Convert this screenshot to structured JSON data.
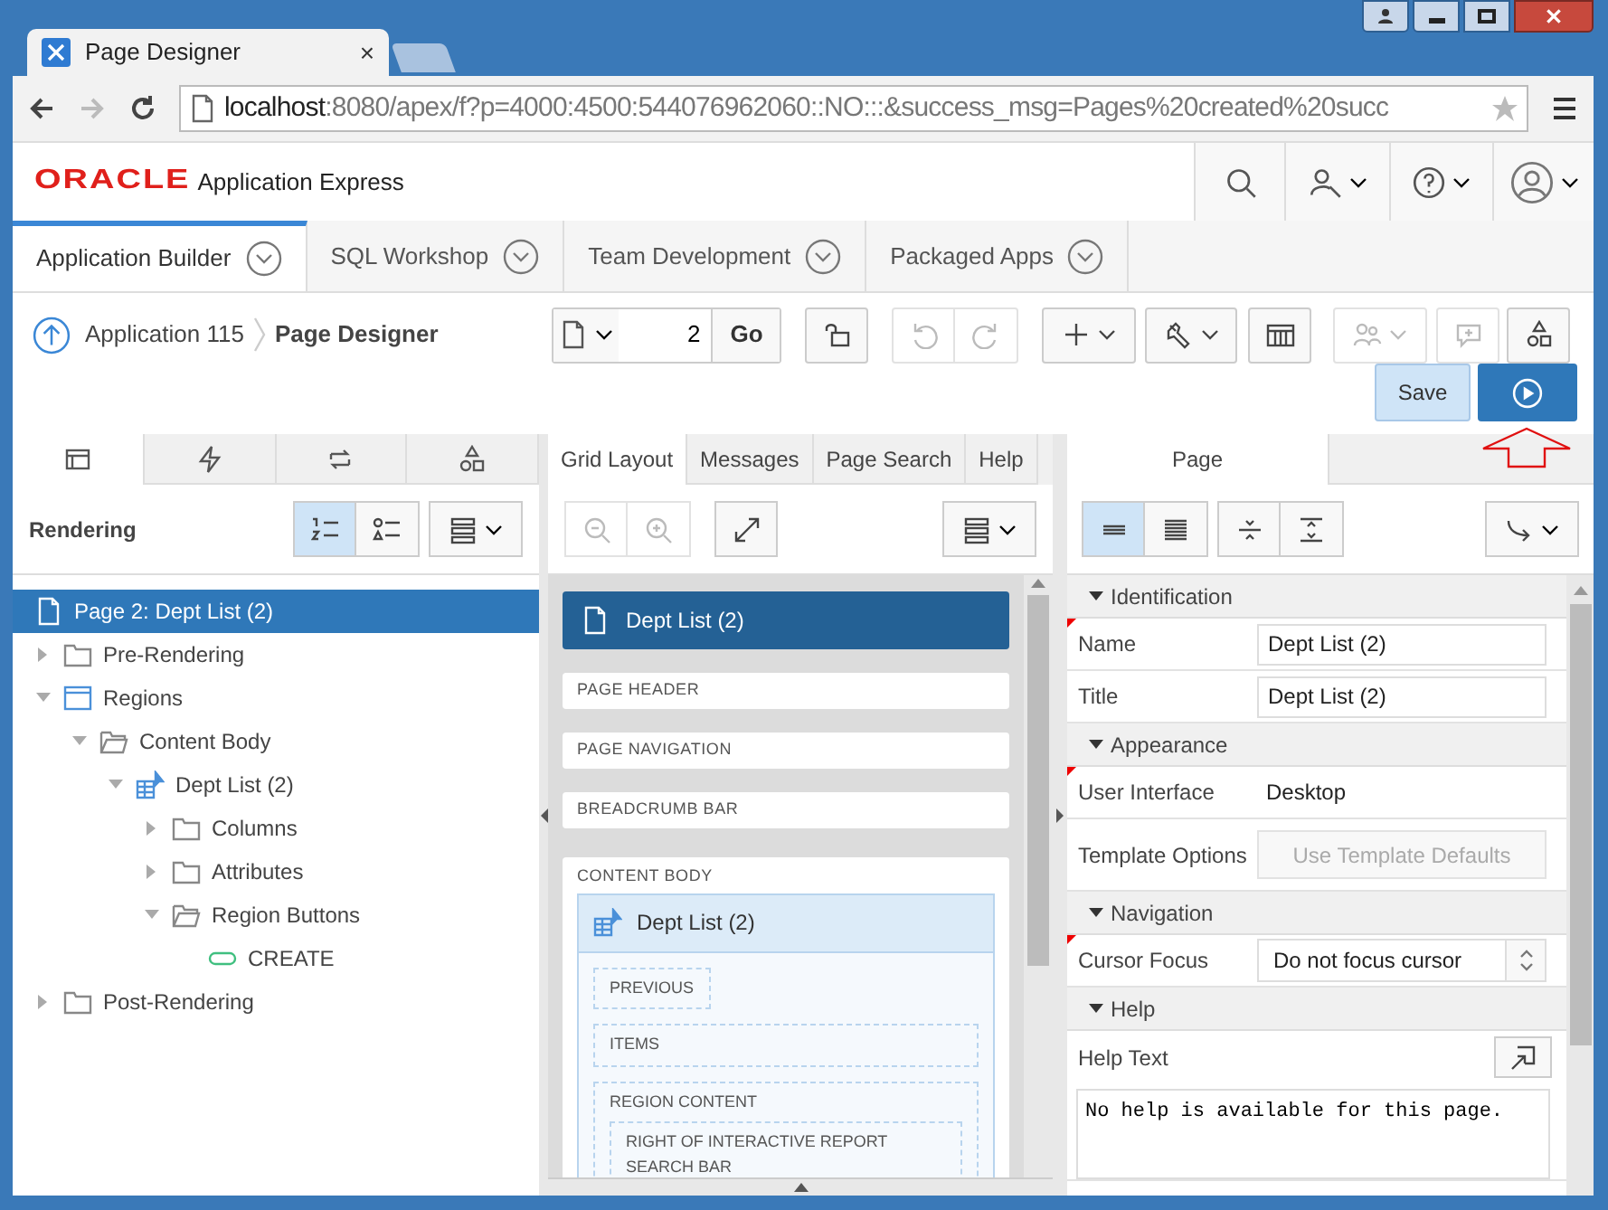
{
  "browser": {
    "tab_title": "Page Designer",
    "close": "×",
    "url_host": "localhost",
    "url_path": ":8080/apex/f?p=4000:4500:544076962060::NO:::&success_msg=Pages%20created%20succ"
  },
  "header": {
    "brand": "ORACLE",
    "product": "Application Express"
  },
  "nav_tabs": [
    {
      "label": "Application Builder",
      "selected": true
    },
    {
      "label": "SQL Workshop",
      "selected": false
    },
    {
      "label": "Team Development",
      "selected": false
    },
    {
      "label": "Packaged Apps",
      "selected": false
    }
  ],
  "breadcrumb": [
    {
      "label": "Application 115",
      "current": false
    },
    {
      "label": "Page Designer",
      "current": true
    }
  ],
  "page_selector": {
    "value": "2",
    "go": "Go"
  },
  "toolbar": [
    {
      "kind": "lock",
      "disabled": false
    },
    {
      "kind": "undo",
      "disabled": true
    },
    {
      "kind": "redo",
      "disabled": true
    },
    {
      "kind": "add",
      "disabled": false
    },
    {
      "kind": "utilities",
      "disabled": false
    },
    {
      "kind": "layout",
      "disabled": false
    },
    {
      "kind": "team",
      "disabled": true
    },
    {
      "kind": "comment",
      "disabled": true
    },
    {
      "kind": "shared",
      "disabled": false
    }
  ],
  "save": "Save",
  "left_panel": {
    "tabs": [
      {
        "kind": "rendering",
        "selected": true
      },
      {
        "kind": "dynamic",
        "selected": false
      },
      {
        "kind": "processing",
        "selected": false
      },
      {
        "kind": "shared",
        "selected": false
      }
    ],
    "title": "Rendering",
    "views": [
      {
        "kind": "order",
        "selected": true
      },
      {
        "kind": "type",
        "selected": false
      }
    ],
    "tree": [
      {
        "label": "Page 2: Dept List (2)",
        "kind": "page",
        "selected": true
      },
      {
        "label": "Pre-Rendering",
        "kind": "folder",
        "expanded": false,
        "selected": false
      },
      {
        "label": "Regions",
        "kind": "regions",
        "expanded": true,
        "selected": false,
        "children": [
          {
            "label": "Content Body",
            "kind": "folder",
            "expanded": true,
            "selected": false,
            "children": [
              {
                "label": "Dept List (2)",
                "kind": "report",
                "expanded": true,
                "selected": false,
                "children": [
                  {
                    "label": "Columns",
                    "kind": "folder",
                    "expanded": false,
                    "selected": false
                  },
                  {
                    "label": "Attributes",
                    "kind": "folder",
                    "expanded": false,
                    "selected": false
                  },
                  {
                    "label": "Region Buttons",
                    "kind": "folder",
                    "expanded": true,
                    "selected": false,
                    "children": [
                      {
                        "label": "CREATE",
                        "kind": "button",
                        "selected": false
                      }
                    ]
                  }
                ]
              }
            ]
          }
        ]
      },
      {
        "label": "Post-Rendering",
        "kind": "folder",
        "expanded": false,
        "selected": false
      }
    ]
  },
  "middle_panel": {
    "tabs": [
      {
        "label": "Grid Layout",
        "selected": true
      },
      {
        "label": "Messages",
        "selected": false
      },
      {
        "label": "Page Search",
        "selected": false
      },
      {
        "label": "Help",
        "selected": false
      }
    ],
    "page_title": "Dept List (2)",
    "positions": [
      "PAGE HEADER",
      "PAGE NAVIGATION",
      "BREADCRUMB BAR"
    ],
    "content_body": "CONTENT BODY",
    "region": {
      "title": "Dept List (2)",
      "slots": [
        {
          "label": "PREVIOUS",
          "kind": "inline"
        },
        {
          "label": "ITEMS",
          "kind": "full"
        },
        {
          "label": "REGION CONTENT",
          "kind": "full",
          "children": [
            "RIGHT OF INTERACTIVE REPORT SEARCH BAR"
          ]
        }
      ]
    }
  },
  "right_panel": {
    "tab": "Page",
    "views": [
      {
        "kind": "compact",
        "selected": true
      },
      {
        "kind": "full",
        "selected": false
      }
    ],
    "groups": [
      {
        "title": "Identification",
        "expanded": true,
        "properties": [
          {
            "label": "Name",
            "kind": "text",
            "value": "Dept List (2)",
            "required": true
          },
          {
            "label": "Title",
            "kind": "text",
            "value": "Dept List (2)",
            "required": false
          }
        ]
      },
      {
        "title": "Appearance",
        "expanded": true,
        "properties": [
          {
            "label": "User Interface",
            "kind": "static",
            "value": "Desktop",
            "required": true
          },
          {
            "label": "Template Options",
            "kind": "button",
            "value": "Use Template Defaults",
            "required": false
          }
        ]
      },
      {
        "title": "Navigation",
        "expanded": true,
        "properties": [
          {
            "label": "Cursor Focus",
            "kind": "select",
            "value": "Do not focus cursor",
            "required": true
          }
        ]
      },
      {
        "title": "Help",
        "expanded": true,
        "properties": [
          {
            "label": "Help Text",
            "kind": "textarea",
            "value": "No help is available for this page.",
            "required": false
          }
        ]
      }
    ]
  }
}
